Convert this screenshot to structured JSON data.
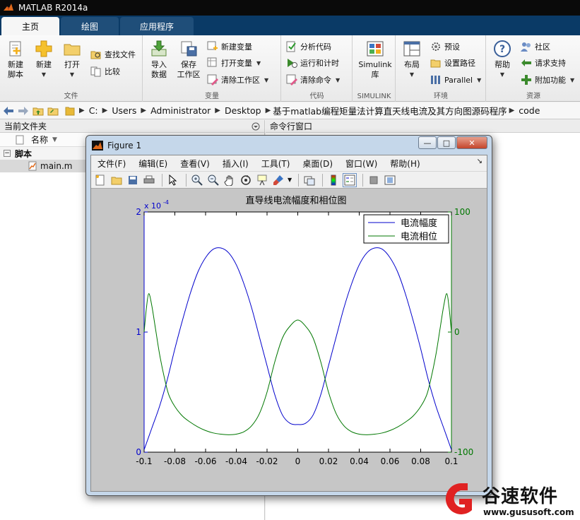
{
  "app": {
    "title": "MATLAB R2014a",
    "colors": {
      "titlebar": "#0a0a0a",
      "tabbar": "#0a3a66",
      "accent": "#1f4e79"
    }
  },
  "tabs": [
    {
      "label": "主页",
      "active": true
    },
    {
      "label": "绘图",
      "active": false
    },
    {
      "label": "应用程序",
      "active": false
    }
  ],
  "ribbon": {
    "file_group": {
      "label": "文件",
      "new_script": "新建\n脚本",
      "new": "新建",
      "open": "打开",
      "find_files": "查找文件",
      "compare": "比较"
    },
    "variable_group": {
      "label": "变量",
      "import_data": "导入\n数据",
      "save_workspace": "保存\n工作区",
      "new_variable": "新建变量",
      "open_variable": "打开变量",
      "clear_workspace": "清除工作区"
    },
    "code_group": {
      "label": "代码",
      "analyze_code": "分析代码",
      "run_and_time": "运行和计时",
      "clear_commands": "清除命令"
    },
    "simulink_group": {
      "label": "SIMULINK",
      "simulink_library": "Simulink\n库"
    },
    "environment_group": {
      "label": "环境",
      "layout": "布局",
      "preferences": "预设",
      "set_path": "设置路径",
      "parallel": "Parallel"
    },
    "resources_group": {
      "label": "资源",
      "help": "帮助",
      "community": "社区",
      "request_support": "请求支持",
      "add_ons": "附加功能"
    }
  },
  "address_bar": {
    "path": [
      "C:",
      "Users",
      "Administrator",
      "Desktop",
      "基于matlab编程矩量法计算直天线电流及其方向图源码程序",
      "code"
    ]
  },
  "current_folder": {
    "title": "当前文件夹",
    "column_name": "名称",
    "group": "脚本",
    "files": [
      "main.m"
    ]
  },
  "command_window": {
    "title": "命令行窗口"
  },
  "figure": {
    "title": "Figure 1",
    "menu": [
      "文件(F)",
      "编辑(E)",
      "查看(V)",
      "插入(I)",
      "工具(T)",
      "桌面(D)",
      "窗口(W)",
      "帮助(H)"
    ],
    "window_buttons": {
      "minimize": "—",
      "maximize": "□",
      "close": "✕"
    }
  },
  "chart_data": {
    "type": "line",
    "title": "直导线电流幅度和相位图",
    "xlim": [
      -0.1,
      0.1
    ],
    "xticks": [
      "-0.1",
      "-0.08",
      "-0.06",
      "-0.04",
      "-0.02",
      "0",
      "0.02",
      "0.04",
      "0.06",
      "0.08",
      "0.1"
    ],
    "left_axis": {
      "ylim": [
        0,
        2
      ],
      "ticks": [
        "0",
        "1",
        "2"
      ],
      "exponent": "x 10",
      "exponent_power": "-4",
      "color": "#0000cc"
    },
    "right_axis": {
      "ylim": [
        -100,
        100
      ],
      "ticks": [
        "-100",
        "0",
        "100"
      ],
      "color": "#007700"
    },
    "legend_position": "top-right",
    "grid": false,
    "series": [
      {
        "name": "电流幅度",
        "axis": "left",
        "color": "#0000cc",
        "x": [
          -0.1,
          -0.095,
          -0.09,
          -0.085,
          -0.08,
          -0.075,
          -0.07,
          -0.065,
          -0.06,
          -0.055,
          -0.05,
          -0.045,
          -0.04,
          -0.035,
          -0.03,
          -0.025,
          -0.02,
          -0.015,
          -0.01,
          -0.005,
          0,
          0.005,
          0.01,
          0.015,
          0.02,
          0.025,
          0.03,
          0.035,
          0.04,
          0.045,
          0.05,
          0.055,
          0.06,
          0.065,
          0.07,
          0.075,
          0.08,
          0.085,
          0.09,
          0.095,
          0.1
        ],
        "y": [
          0.02,
          0.2,
          0.38,
          0.6,
          0.86,
          1.1,
          1.32,
          1.5,
          1.62,
          1.69,
          1.7,
          1.66,
          1.56,
          1.4,
          1.2,
          0.96,
          0.72,
          0.48,
          0.31,
          0.24,
          0.23,
          0.24,
          0.31,
          0.48,
          0.72,
          0.96,
          1.2,
          1.4,
          1.56,
          1.66,
          1.7,
          1.69,
          1.62,
          1.5,
          1.32,
          1.1,
          0.86,
          0.6,
          0.38,
          0.2,
          0.02
        ]
      },
      {
        "name": "电流相位",
        "axis": "right",
        "color": "#007700",
        "x": [
          -0.1,
          -0.0985,
          -0.097,
          -0.095,
          -0.0925,
          -0.09,
          -0.087,
          -0.084,
          -0.08,
          -0.075,
          -0.07,
          -0.065,
          -0.06,
          -0.055,
          -0.05,
          -0.045,
          -0.04,
          -0.035,
          -0.03,
          -0.025,
          -0.02,
          -0.015,
          -0.01,
          -0.005,
          0,
          0.005,
          0.01,
          0.015,
          0.02,
          0.025,
          0.03,
          0.035,
          0.04,
          0.045,
          0.05,
          0.055,
          0.06,
          0.065,
          0.07,
          0.075,
          0.08,
          0.084,
          0.087,
          0.09,
          0.0925,
          0.095,
          0.097,
          0.0985,
          0.1
        ],
        "y": [
          0,
          20,
          32,
          22,
          2,
          -18,
          -37,
          -52,
          -62,
          -70,
          -75,
          -79,
          -82,
          -84,
          -85,
          -85.5,
          -85,
          -83,
          -78,
          -68,
          -50,
          -25,
          -5,
          5,
          10,
          5,
          -5,
          -25,
          -50,
          -68,
          -78,
          -83,
          -85,
          -85.5,
          -85,
          -84,
          -82,
          -79,
          -75,
          -70,
          -62,
          -52,
          -37,
          -18,
          2,
          22,
          32,
          20,
          0
        ]
      }
    ]
  },
  "watermark": {
    "brand": "谷速软件",
    "url": "www.gususoft.com"
  }
}
